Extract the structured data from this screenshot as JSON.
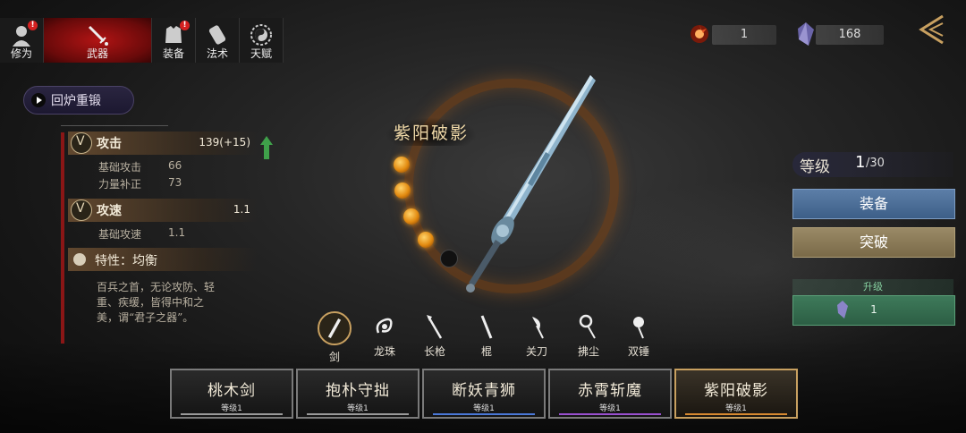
{
  "tabs": [
    {
      "label": "修为",
      "icon": "person-icon",
      "badge": "!"
    },
    {
      "label": "武器",
      "icon": "sword-icon",
      "badge": ""
    },
    {
      "label": "装备",
      "icon": "armor-icon",
      "badge": "!"
    },
    {
      "label": "法术",
      "icon": "scroll-icon",
      "badge": ""
    },
    {
      "label": "天赋",
      "icon": "yinyang-icon",
      "badge": ""
    }
  ],
  "currency": {
    "orb": "1",
    "crystal": "168"
  },
  "reforge_label": "回炉重锻",
  "stats": {
    "attack": {
      "name": "攻击",
      "value": "139(+15)",
      "subs": [
        {
          "name": "基础攻击",
          "value": "66"
        },
        {
          "name": "力量补正",
          "value": "73"
        }
      ]
    },
    "speed": {
      "name": "攻速",
      "value": "1.1",
      "subs": [
        {
          "name": "基础攻速",
          "value": "1.1"
        }
      ]
    },
    "trait": "特性：均衡",
    "description": "百兵之首，无论攻防、轻重、疾缓，皆得中和之美，谓“君子之器”。"
  },
  "weapon": {
    "name": "紫阳破影",
    "filled_orbs": 4,
    "total_orbs": 5
  },
  "weapon_types": [
    "剑",
    "龙珠",
    "长枪",
    "棍",
    "关刀",
    "拂尘",
    "双锤"
  ],
  "level": {
    "label": "等级",
    "current": "1",
    "max": "/30"
  },
  "buttons": {
    "equip": "装备",
    "breakthrough": "突破"
  },
  "upgrade": {
    "title": "升级",
    "cost": "1"
  },
  "cards": [
    {
      "name": "桃木剑",
      "level": "等级1",
      "bar": "#9a9a9a"
    },
    {
      "name": "抱朴守拙",
      "level": "等级1",
      "bar": "#9a9a9a"
    },
    {
      "name": "断妖青狮",
      "level": "等级1",
      "bar": "#4a78d8"
    },
    {
      "name": "赤霄斩魔",
      "level": "等级1",
      "bar": "#9a50d0"
    },
    {
      "name": "紫阳破影",
      "level": "等级1",
      "bar": "#d88a30"
    }
  ],
  "colors": {
    "accent_red": "#b11414",
    "equip_blue": "#5c7ea8",
    "break_gold": "#9a8a66",
    "upgrade_green": "#3e7a5a"
  }
}
